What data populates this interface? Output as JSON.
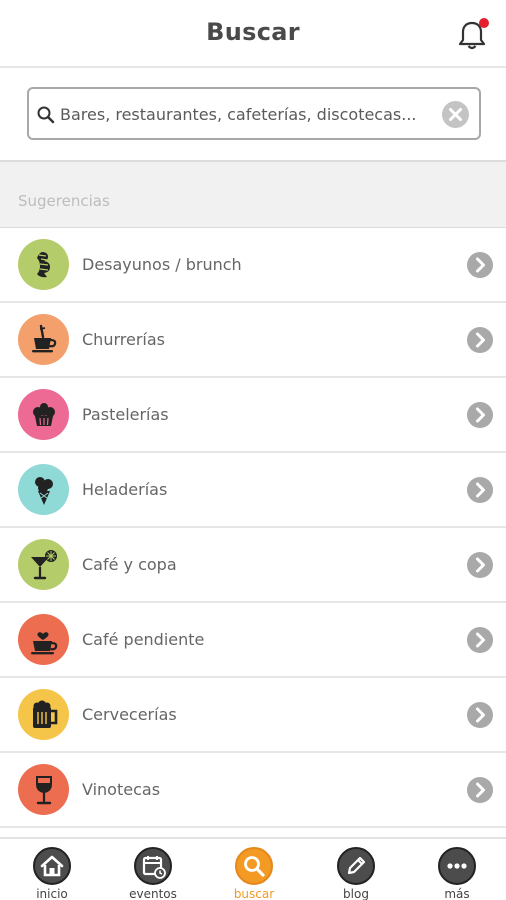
{
  "header": {
    "title": "Buscar"
  },
  "search": {
    "placeholder": "Bares, restaurantes, cafeterías, discotecas..."
  },
  "suggestions": {
    "heading": "Sugerencias",
    "items": [
      {
        "label": "Desayunos / brunch",
        "icon": "croissant-icon",
        "color": "#b5cc6a"
      },
      {
        "label": "Churrerías",
        "icon": "churro-cup-icon",
        "color": "#f3a06c"
      },
      {
        "label": "Pastelerías",
        "icon": "cupcake-icon",
        "color": "#ec6a93"
      },
      {
        "label": "Heladerías",
        "icon": "ice-cream-icon",
        "color": "#8fd9d6"
      },
      {
        "label": "Café y copa",
        "icon": "cocktail-icon",
        "color": "#b5cc6a"
      },
      {
        "label": "Café pendiente",
        "icon": "heart-cup-icon",
        "color": "#ec6d50"
      },
      {
        "label": "Cervecerías",
        "icon": "beer-mug-icon",
        "color": "#f4c548"
      },
      {
        "label": "Vinotecas",
        "icon": "wine-glass-icon",
        "color": "#ec6d50"
      }
    ]
  },
  "tabbar": {
    "items": [
      {
        "label": "inicio",
        "icon": "home-icon"
      },
      {
        "label": "eventos",
        "icon": "calendar-icon"
      },
      {
        "label": "buscar",
        "icon": "search-icon",
        "active": true
      },
      {
        "label": "blog",
        "icon": "pencil-icon"
      },
      {
        "label": "más",
        "icon": "more-icon"
      }
    ]
  },
  "colors": {
    "accent": "#f29a24",
    "notification": "#e5202e"
  }
}
